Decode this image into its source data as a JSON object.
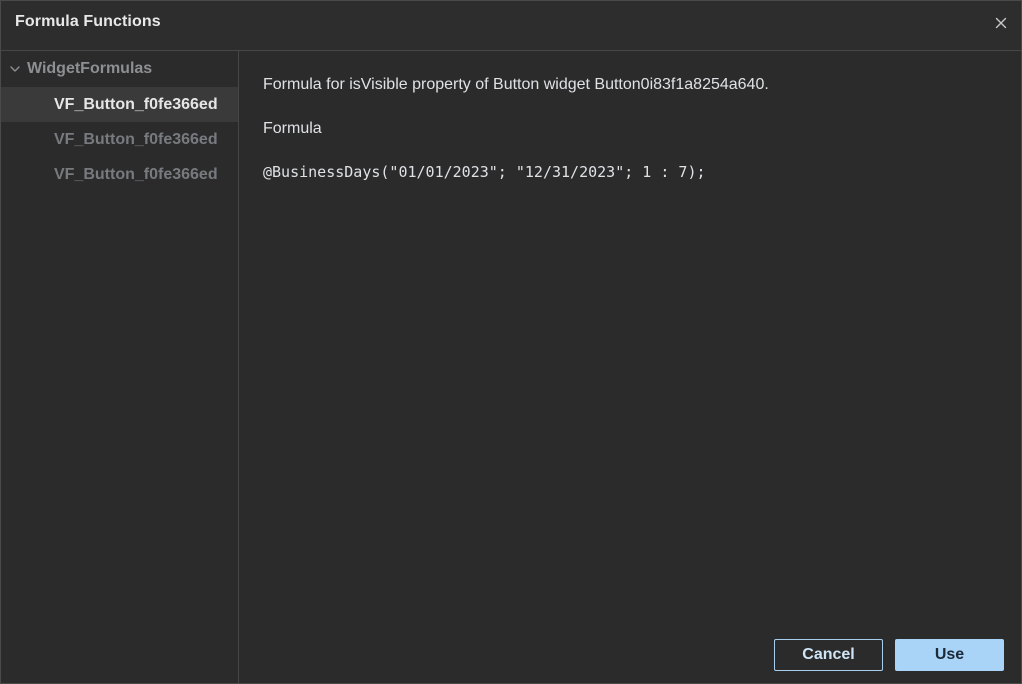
{
  "dialog": {
    "title": "Formula Functions",
    "close_icon": "close-icon"
  },
  "tree": {
    "root_label": "WidgetFormulas",
    "root_icon": "chevron-down-icon",
    "items": [
      {
        "label": "VF_Button_f0fe366ed",
        "selected": true
      },
      {
        "label": "VF_Button_f0fe366ed",
        "selected": false
      },
      {
        "label": "VF_Button_f0fe366ed",
        "selected": false
      }
    ]
  },
  "detail": {
    "description": "Formula for isVisible property of Button widget Button0i83f1a8254a640.",
    "formula_label": "Formula",
    "formula_code": "@BusinessDays(\"01/01/2023\"; \"12/31/2023\"; 1 : 7);"
  },
  "buttons": {
    "cancel": "Cancel",
    "use": "Use"
  },
  "colors": {
    "background": "#2b2b2b",
    "selected_row": "#3a3a3b",
    "accent": "#a9d3f7"
  }
}
